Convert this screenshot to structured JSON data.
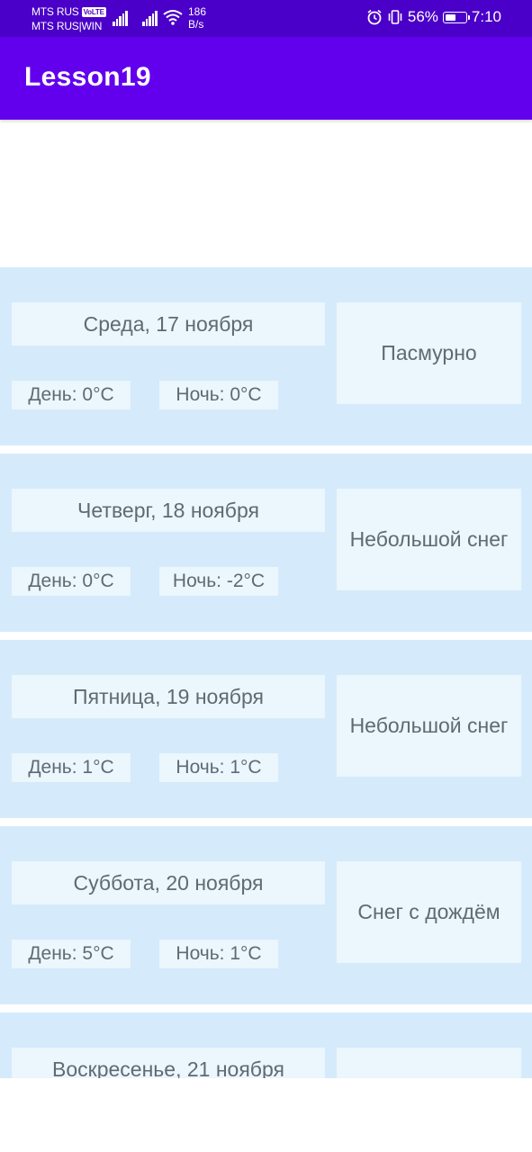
{
  "status_bar": {
    "carrier1": "MTS RUS",
    "volte": "VoLTE",
    "carrier2": "MTS RUS|WIN",
    "speed_value": "186",
    "speed_unit": "B/s",
    "battery_percent": "56%",
    "battery_level": 0.56,
    "time": "7:10",
    "icons": [
      "signal-icon",
      "signal-icon",
      "wifi-icon",
      "alarm-icon",
      "vibrate-icon",
      "battery-icon"
    ]
  },
  "app_bar": {
    "title": "Lesson19",
    "color": "#6200ee"
  },
  "forecast": [
    {
      "date": "Среда, 17 ноября",
      "day": "День: 0°C",
      "night": "Ночь: 0°C",
      "condition": "Пасмурно"
    },
    {
      "date": "Четверг, 18 ноября",
      "day": "День: 0°C",
      "night": "Ночь: -2°C",
      "condition": "Небольшой снег"
    },
    {
      "date": "Пятница, 19 ноября",
      "day": "День: 1°C",
      "night": "Ночь: 1°C",
      "condition": "Небольшой снег"
    },
    {
      "date": "Суббота, 20 ноября",
      "day": "День: 5°C",
      "night": "Ночь: 1°C",
      "condition": "Снег с дождём"
    },
    {
      "date": "Воскресенье, 21 ноября",
      "day": "",
      "night": "",
      "condition": ""
    }
  ],
  "colors": {
    "status_bar": "#4a00c8",
    "card_background": "#d5ebfb",
    "cell_background": "#ebf6fd",
    "text": "#5f6a73"
  }
}
